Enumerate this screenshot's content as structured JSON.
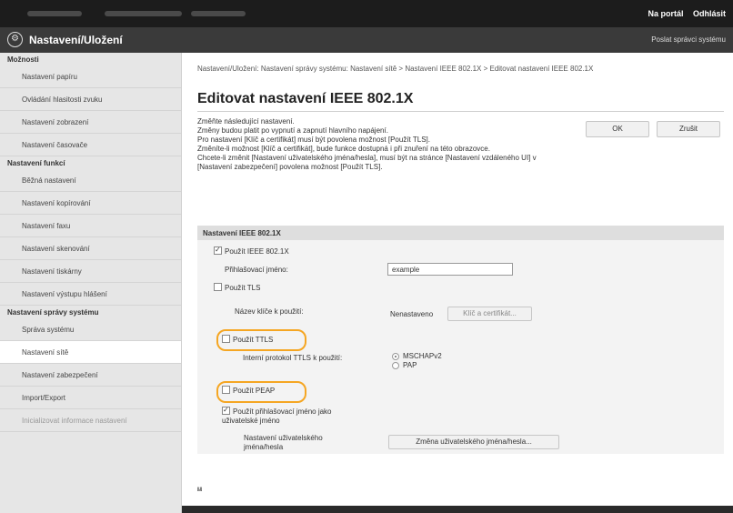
{
  "topbar": {
    "portal_link": "Na portál",
    "logout_link": "Odhlásit"
  },
  "appbar": {
    "logo_glyph": "⚙",
    "title": "Nastavení/Uložení",
    "sys_link": "Poslat správci systému"
  },
  "sidebar": {
    "section_preferences": "Možnosti",
    "preferences": [
      "Nastavení papíru",
      "Ovládání hlasitosti zvuku",
      "Nastavení zobrazení",
      "Nastavení časovače"
    ],
    "section_function": "Nastavení funkcí",
    "function": [
      "Běžná nastavení",
      "Nastavení kopírování",
      "Nastavení faxu",
      "Nastavení skenování",
      "Nastavení tiskárny",
      "Nastavení výstupu hlášení"
    ],
    "section_management": "Nastavení správy systému",
    "management": [
      "Správa systému",
      "Nastavení sítě",
      "Nastavení zabezpečení",
      "Import/Export",
      "Inicializovat informace nastavení"
    ]
  },
  "breadcrumb": "Nastavení/Uložení: Nastavení správy systému: Nastavení sítě > Nastavení IEEE 802.1X > Editovat nastavení IEEE 802.1X",
  "page_title": "Editovat nastavení IEEE 802.1X",
  "notes": {
    "line1": "Změňte následující nastavení.",
    "line2": "Změny budou platit po vypnutí a zapnutí hlavního napájení.",
    "line3": "Pro nastavení [Klíč a certifikát] musí být povolena možnost [Použít TLS].",
    "line4": "Změníte-li možnost [Klíč a certifikát], bude funkce dostupná i při znuření na této obrazovce.",
    "line5": "Chcete-li změnit [Nastavení uživatelského jména/hesla], musí být na stránce [Nastavení vzdáleného UI] v [Nastavení zabezpečení] povolena možnost [Použít TLS]."
  },
  "buttons": {
    "ok": "OK",
    "cancel": "Zrušit"
  },
  "section": {
    "title": "Nastavení IEEE 802.1X",
    "use_ieee": "Použít IEEE 802.1X",
    "login_label": "Přihlašovací jméno:",
    "login_value": "example",
    "use_tls": "Použít TLS",
    "key_label": "Název klíče k použití:",
    "key_status": "Nenastaveno",
    "key_button": "Klíč a certifikát...",
    "use_ttls": "Použít TTLS",
    "ttls_protocol_label": "Interní protokol TTLS k použití:",
    "ttls_option1": "MSCHAPv2",
    "ttls_option2": "PAP",
    "use_peap": "Použít PEAP",
    "use_login_as_user": "Použít přihlašovací jméno jako uživatelské jméno",
    "userpass_label": "Nastavení uživatelského jména/hesla",
    "userpass_button": "Změna uživatelského jména/hesla..."
  },
  "back_to_top": "⩏"
}
